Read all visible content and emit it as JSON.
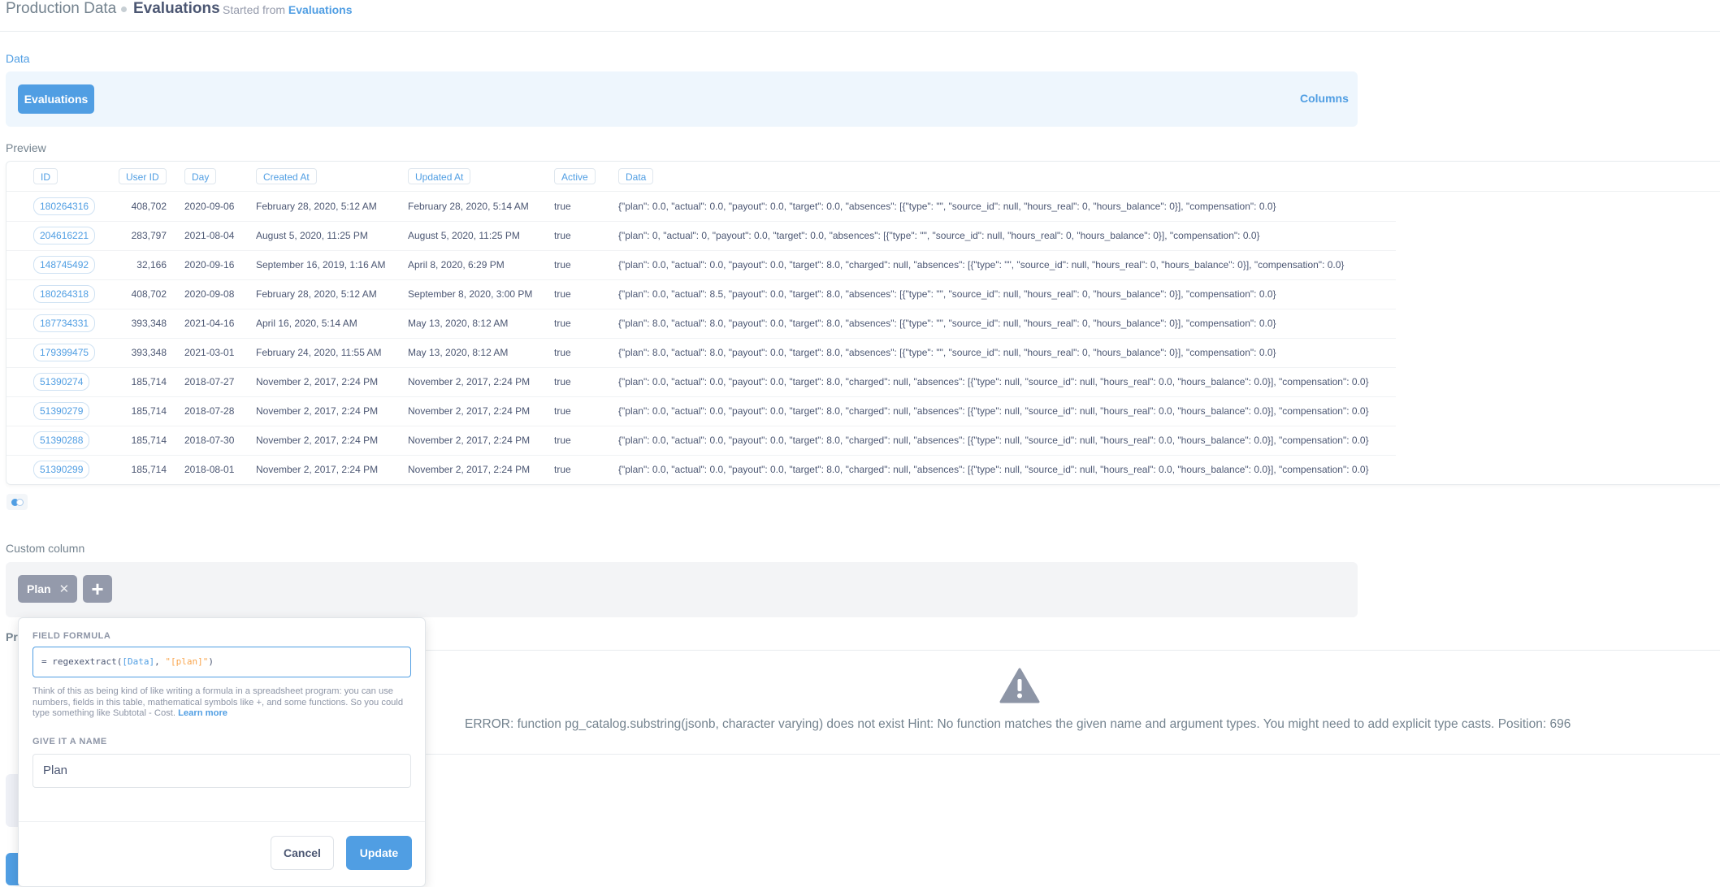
{
  "header": {
    "parent": "Production Data",
    "title": "Evaluations",
    "started_prefix": "Started from",
    "started_link": "Evaluations"
  },
  "data_step": {
    "label": "Data",
    "table": "Evaluations",
    "columns_link": "Columns"
  },
  "preview": {
    "label": "Preview",
    "columns": [
      "ID",
      "User ID",
      "Day",
      "Created At",
      "Updated At",
      "Active",
      "Data"
    ],
    "rows": [
      [
        "180264316",
        "408,702",
        "2020-09-06",
        "February 28, 2020, 5:12 AM",
        "February 28, 2020, 5:14 AM",
        "true",
        "{\"plan\": 0.0, \"actual\": 0.0, \"payout\": 0.0, \"target\": 0.0, \"absences\": [{\"type\": \"\", \"source_id\": null, \"hours_real\": 0, \"hours_balance\": 0}], \"compensation\": 0.0}"
      ],
      [
        "204616221",
        "283,797",
        "2021-08-04",
        "August 5, 2020, 11:25 PM",
        "August 5, 2020, 11:25 PM",
        "true",
        "{\"plan\": 0, \"actual\": 0, \"payout\": 0.0, \"target\": 0.0, \"absences\": [{\"type\": \"\", \"source_id\": null, \"hours_real\": 0, \"hours_balance\": 0}], \"compensation\": 0.0}"
      ],
      [
        "148745492",
        "32,166",
        "2020-09-16",
        "September 16, 2019, 1:16 AM",
        "April 8, 2020, 6:29 PM",
        "true",
        "{\"plan\": 0.0, \"actual\": 0.0, \"payout\": 0.0, \"target\": 8.0, \"charged\": null, \"absences\": [{\"type\": \"\", \"source_id\": null, \"hours_real\": 0, \"hours_balance\": 0}], \"compensation\": 0.0}"
      ],
      [
        "180264318",
        "408,702",
        "2020-09-08",
        "February 28, 2020, 5:12 AM",
        "September 8, 2020, 3:00 PM",
        "true",
        "{\"plan\": 0.0, \"actual\": 8.5, \"payout\": 0.0, \"target\": 8.0, \"absences\": [{\"type\": \"\", \"source_id\": null, \"hours_real\": 0, \"hours_balance\": 0}], \"compensation\": 0.0}"
      ],
      [
        "187734331",
        "393,348",
        "2021-04-16",
        "April 16, 2020, 5:14 AM",
        "May 13, 2020, 8:12 AM",
        "true",
        "{\"plan\": 8.0, \"actual\": 8.0, \"payout\": 0.0, \"target\": 8.0, \"absences\": [{\"type\": \"\", \"source_id\": null, \"hours_real\": 0, \"hours_balance\": 0}], \"compensation\": 0.0}"
      ],
      [
        "179399475",
        "393,348",
        "2021-03-01",
        "February 24, 2020, 11:55 AM",
        "May 13, 2020, 8:12 AM",
        "true",
        "{\"plan\": 8.0, \"actual\": 8.0, \"payout\": 0.0, \"target\": 8.0, \"absences\": [{\"type\": \"\", \"source_id\": null, \"hours_real\": 0, \"hours_balance\": 0}], \"compensation\": 0.0}"
      ],
      [
        "51390274",
        "185,714",
        "2018-07-27",
        "November 2, 2017, 2:24 PM",
        "November 2, 2017, 2:24 PM",
        "true",
        "{\"plan\": 0.0, \"actual\": 0.0, \"payout\": 0.0, \"target\": 8.0, \"charged\": null, \"absences\": [{\"type\": null, \"source_id\": null, \"hours_real\": 0.0, \"hours_balance\": 0.0}], \"compensation\": 0.0}"
      ],
      [
        "51390279",
        "185,714",
        "2018-07-28",
        "November 2, 2017, 2:24 PM",
        "November 2, 2017, 2:24 PM",
        "true",
        "{\"plan\": 0.0, \"actual\": 0.0, \"payout\": 0.0, \"target\": 8.0, \"charged\": null, \"absences\": [{\"type\": null, \"source_id\": null, \"hours_real\": 0.0, \"hours_balance\": 0.0}], \"compensation\": 0.0}"
      ],
      [
        "51390288",
        "185,714",
        "2018-07-30",
        "November 2, 2017, 2:24 PM",
        "November 2, 2017, 2:24 PM",
        "true",
        "{\"plan\": 0.0, \"actual\": 0.0, \"payout\": 0.0, \"target\": 8.0, \"charged\": null, \"absences\": [{\"type\": null, \"source_id\": null, \"hours_real\": 0.0, \"hours_balance\": 0.0}], \"compensation\": 0.0}"
      ],
      [
        "51390299",
        "185,714",
        "2018-08-01",
        "November 2, 2017, 2:24 PM",
        "November 2, 2017, 2:24 PM",
        "true",
        "{\"plan\": 0.0, \"actual\": 0.0, \"payout\": 0.0, \"target\": 8.0, \"charged\": null, \"absences\": [{\"type\": null, \"source_id\": null, \"hours_real\": 0.0, \"hours_balance\": 0.0}], \"compensation\": 0.0}"
      ]
    ]
  },
  "custom_column": {
    "label": "Custom column",
    "pill": "Plan",
    "remove_icon": "close-icon",
    "add_icon": "plus-icon"
  },
  "result": {
    "label_partial": "Pr",
    "warning_icon": "warning-icon",
    "error": "ERROR: function pg_catalog.substring(jsonb, character varying) does not exist Hint: No function matches the given name and argument types. You might need to add explicit type casts. Position: 696"
  },
  "popover": {
    "formula_label": "FIELD FORMULA",
    "formula_prefix": "= regexextract(",
    "formula_field": "[Data]",
    "formula_sep": ", ",
    "formula_string": "\"[plan]\"",
    "formula_suffix": ")",
    "help_text": "Think of this as being kind of like writing a formula in a spreadsheet program: you can use numbers, fields in this table, mathematical symbols like +, and some functions. So you could type something like Subtotal - Cost.",
    "learn_more": "Learn more",
    "name_label": "GIVE IT A NAME",
    "name_value": "Plan",
    "cancel": "Cancel",
    "update": "Update"
  },
  "colors": {
    "brand": "#509ee3",
    "text": "#4c5773",
    "muted": "#949aab",
    "string_token": "#f9a64e"
  }
}
